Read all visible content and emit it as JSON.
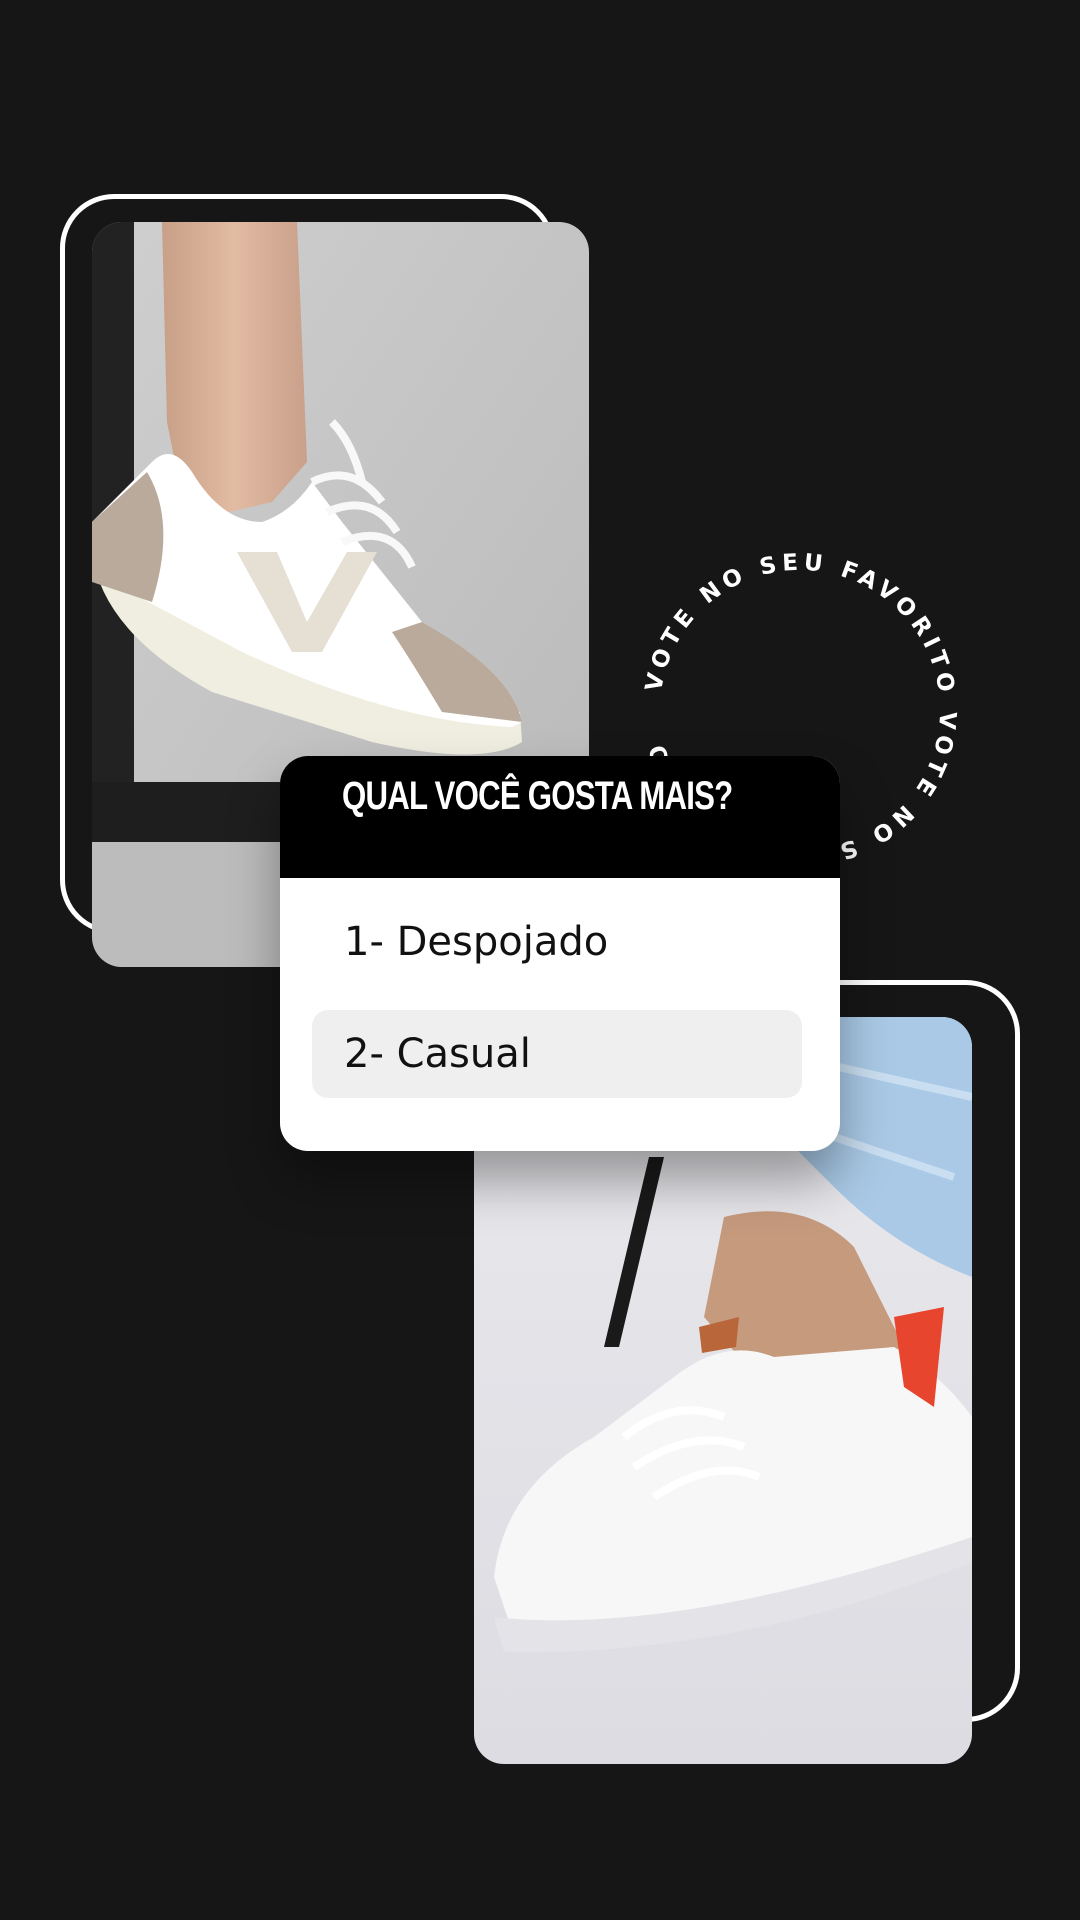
{
  "poll": {
    "question": "QUAL VOCÊ GOSTA MAIS?",
    "options": [
      {
        "label": "1- Despojado"
      },
      {
        "label": "2- Casual"
      }
    ]
  },
  "badge": {
    "circular_text": "VOTE NO SEU FAVORITO VOTE NO SEU FAVORITO "
  },
  "colors": {
    "background": "#161616",
    "frame": "#ffffff",
    "poll_header": "#000000",
    "poll_option_highlight": "#efefef",
    "sneaker_accent_top": "#b9aa9b",
    "sneaker_accent_bottom": "#e8452e"
  },
  "images": {
    "top": "beige-and-white-sneaker-photo",
    "bottom": "white-sneaker-with-jeans-photo"
  }
}
